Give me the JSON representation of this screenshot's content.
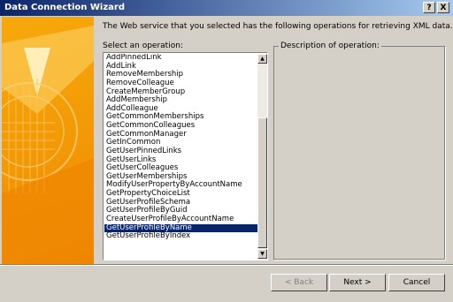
{
  "window": {
    "title": "Data Connection Wizard",
    "help_label": "?",
    "close_label": "X"
  },
  "intro_text": "The Web service that you selected has the following operations for retrieving XML data.",
  "operations": {
    "label": "Select an operation:",
    "items": [
      "AddPinnedLink",
      "AddLink",
      "RemoveMembership",
      "RemoveColleague",
      "CreateMemberGroup",
      "AddMembership",
      "AddColleague",
      "GetCommonMemberships",
      "GetCommonColleagues",
      "GetCommonManager",
      "GetInCommon",
      "GetUserPinnedLinks",
      "GetUserLinks",
      "GetUserColleagues",
      "GetUserMemberships",
      "ModifyUserPropertyByAccountName",
      "GetPropertyChoiceList",
      "GetUserProfileSchema",
      "GetUserProfileByGuid",
      "CreateUserProfileByAccountName",
      "GetUserProfileByName",
      "GetUserProfileByIndex"
    ],
    "selected": "GetUserProfileByName"
  },
  "description": {
    "label": "Description of operation:"
  },
  "buttons": {
    "back": "< Back",
    "next": "Next >",
    "cancel": "Cancel"
  },
  "colors": {
    "titlebar_start": "#0a246a",
    "titlebar_end": "#a6caf0",
    "selection": "#0a246a",
    "art_orange": "#f4a10a"
  }
}
